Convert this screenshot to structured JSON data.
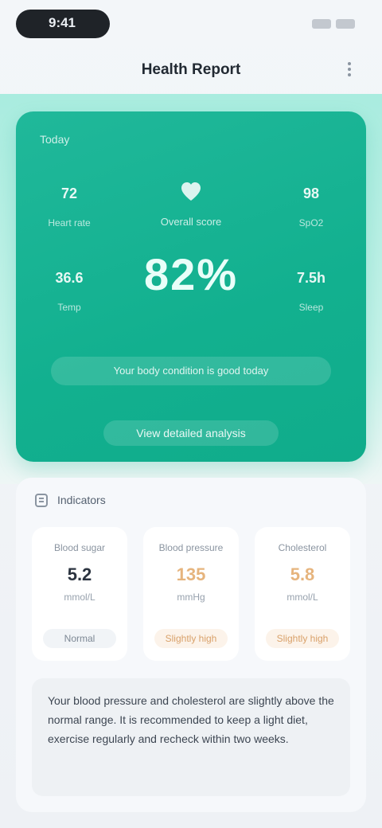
{
  "status_bar": {
    "time": "9:41"
  },
  "nav": {
    "title": "Health Report"
  },
  "hero": {
    "label": "Today",
    "center_sub": "Overall score",
    "score": "82%",
    "metrics": [
      {
        "value": "72",
        "label": "Heart rate"
      },
      {
        "value": "98",
        "label": "SpO2"
      },
      {
        "value": "36.6",
        "label": "Temp"
      },
      {
        "value": "7.5h",
        "label": "Sleep"
      }
    ],
    "note": "Your body condition is good today",
    "button": "View detailed analysis"
  },
  "card": {
    "title": "Indicators",
    "tiles": [
      {
        "label": "Blood sugar",
        "value": "5.2",
        "unit": "mmol/L",
        "status": "Normal",
        "state": "normal"
      },
      {
        "label": "Blood pressure",
        "value": "135",
        "unit": "mmHg",
        "status": "Slightly high",
        "state": "warn"
      },
      {
        "label": "Cholesterol",
        "value": "5.8",
        "unit": "mmol/L",
        "status": "Slightly high",
        "state": "warn"
      }
    ],
    "description": "Your blood pressure and cholesterol are slightly above the normal range. It is recommended to keep a light diet, exercise regularly and recheck within two weeks."
  },
  "colors": {
    "accent": "#12b08f",
    "warn": "#e6b47d"
  }
}
